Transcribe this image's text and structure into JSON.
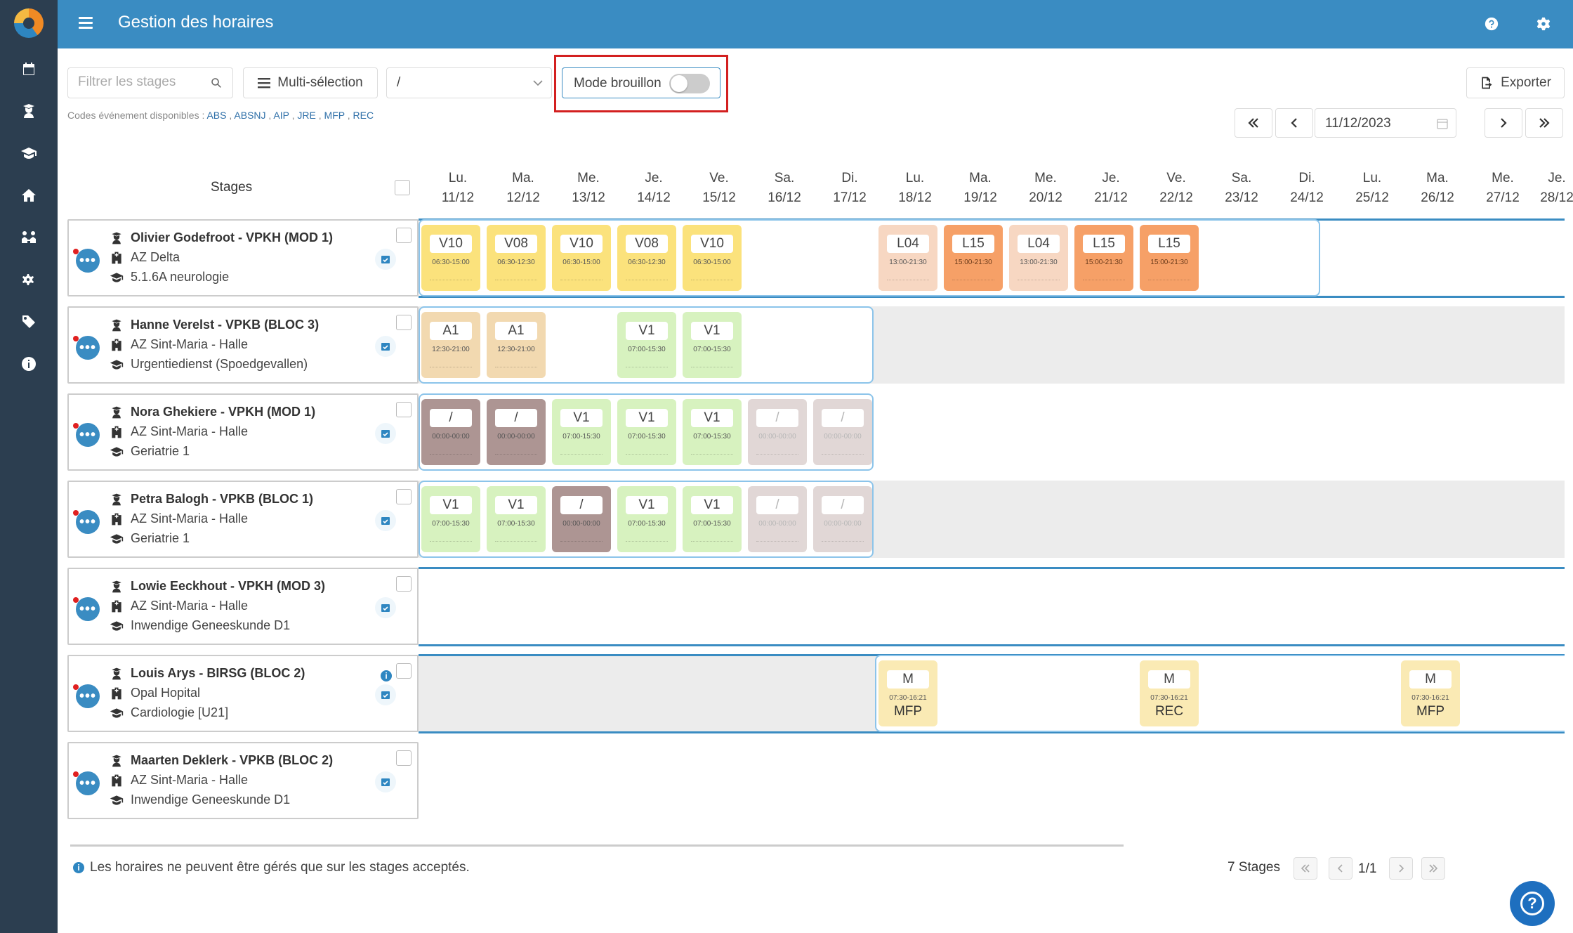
{
  "header": {
    "title": "Gestion des horaires"
  },
  "toolbar": {
    "search_placeholder": "Filtrer les stages",
    "multi_label": "Multi-sélection",
    "select_value": "/",
    "draft_label": "Mode brouillon",
    "draft_on": false,
    "export_label": "Exporter",
    "codes_label": "Codes événement disponibles :",
    "codes": [
      "ABS",
      "ABSNJ",
      "AIP",
      "JRE",
      "MFP",
      "REC"
    ],
    "date": "11/12/2023"
  },
  "grid": {
    "stages_header": "Stages",
    "days": [
      {
        "d": "Lu.",
        "date": "11/12"
      },
      {
        "d": "Ma.",
        "date": "12/12"
      },
      {
        "d": "Me.",
        "date": "13/12"
      },
      {
        "d": "Je.",
        "date": "14/12"
      },
      {
        "d": "Ve.",
        "date": "15/12"
      },
      {
        "d": "Sa.",
        "date": "16/12"
      },
      {
        "d": "Di.",
        "date": "17/12"
      },
      {
        "d": "Lu.",
        "date": "18/12"
      },
      {
        "d": "Ma.",
        "date": "19/12"
      },
      {
        "d": "Me.",
        "date": "20/12"
      },
      {
        "d": "Je.",
        "date": "21/12"
      },
      {
        "d": "Ve.",
        "date": "22/12"
      },
      {
        "d": "Sa.",
        "date": "23/12"
      },
      {
        "d": "Di.",
        "date": "24/12"
      },
      {
        "d": "Lu.",
        "date": "25/12"
      },
      {
        "d": "Ma.",
        "date": "26/12"
      },
      {
        "d": "Me.",
        "date": "27/12"
      },
      {
        "d": "Je.",
        "date": "28/12"
      }
    ],
    "colors": {
      "yellow": "#fbe27c",
      "peach": "#f7d7c2",
      "orange": "#f6a067",
      "tan": "#f2d9b0",
      "green": "#d7f2bf",
      "brown": "#ad9593",
      "lightbrown": "#dcd1cf",
      "cream": "#faeab4"
    },
    "rows": [
      {
        "name": "Olivier Godefroot - VPKH (MOD 1)",
        "hospital": "AZ Delta",
        "service": "5.1.6A neurologie",
        "shifts": [
          {
            "day": 0,
            "code": "V10",
            "time": "06:30-15:00",
            "color": "yellow"
          },
          {
            "day": 1,
            "code": "V08",
            "time": "06:30-12:30",
            "color": "yellow"
          },
          {
            "day": 2,
            "code": "V10",
            "time": "06:30-15:00",
            "color": "yellow"
          },
          {
            "day": 3,
            "code": "V08",
            "time": "06:30-12:30",
            "color": "yellow"
          },
          {
            "day": 4,
            "code": "V10",
            "time": "06:30-15:00",
            "color": "yellow"
          },
          {
            "day": 7,
            "code": "L04",
            "time": "13:00-21:30",
            "color": "peach"
          },
          {
            "day": 8,
            "code": "L15",
            "time": "15:00-21:30",
            "color": "orange"
          },
          {
            "day": 9,
            "code": "L04",
            "time": "13:00-21:30",
            "color": "peach"
          },
          {
            "day": 10,
            "code": "L15",
            "time": "15:00-21:30",
            "color": "orange"
          },
          {
            "day": 11,
            "code": "L15",
            "time": "15:00-21:30",
            "color": "orange"
          }
        ]
      },
      {
        "name": "Hanne Verelst - VPKB (BLOC 3)",
        "hospital": "AZ Sint-Maria - Halle",
        "service": "Urgentiedienst (Spoedgevallen)",
        "shifts": [
          {
            "day": 0,
            "code": "A1",
            "time": "12:30-21:00",
            "color": "tan"
          },
          {
            "day": 1,
            "code": "A1",
            "time": "12:30-21:00",
            "color": "tan"
          },
          {
            "day": 3,
            "code": "V1",
            "time": "07:00-15:30",
            "color": "green"
          },
          {
            "day": 4,
            "code": "V1",
            "time": "07:00-15:30",
            "color": "green"
          }
        ]
      },
      {
        "name": "Nora Ghekiere - VPKH (MOD 1)",
        "hospital": "AZ Sint-Maria - Halle",
        "service": "Geriatrie 1",
        "shifts": [
          {
            "day": 0,
            "code": "/",
            "time": "00:00-00:00",
            "color": "brown"
          },
          {
            "day": 1,
            "code": "/",
            "time": "00:00-00:00",
            "color": "brown"
          },
          {
            "day": 2,
            "code": "V1",
            "time": "07:00-15:30",
            "color": "green"
          },
          {
            "day": 3,
            "code": "V1",
            "time": "07:00-15:30",
            "color": "green"
          },
          {
            "day": 4,
            "code": "V1",
            "time": "07:00-15:30",
            "color": "green"
          },
          {
            "day": 5,
            "code": "/",
            "time": "00:00-00:00",
            "color": "lightbrown"
          },
          {
            "day": 6,
            "code": "/",
            "time": "00:00-00:00",
            "color": "lightbrown"
          }
        ]
      },
      {
        "name": "Petra Balogh - VPKB (BLOC 1)",
        "hospital": "AZ Sint-Maria - Halle",
        "service": "Geriatrie 1",
        "shifts": [
          {
            "day": 0,
            "code": "V1",
            "time": "07:00-15:30",
            "color": "green"
          },
          {
            "day": 1,
            "code": "V1",
            "time": "07:00-15:30",
            "color": "green"
          },
          {
            "day": 2,
            "code": "/",
            "time": "00:00-00:00",
            "color": "brown"
          },
          {
            "day": 3,
            "code": "V1",
            "time": "07:00-15:30",
            "color": "green"
          },
          {
            "day": 4,
            "code": "V1",
            "time": "07:00-15:30",
            "color": "green"
          },
          {
            "day": 5,
            "code": "/",
            "time": "00:00-00:00",
            "color": "lightbrown"
          },
          {
            "day": 6,
            "code": "/",
            "time": "00:00-00:00",
            "color": "lightbrown"
          }
        ]
      },
      {
        "name": "Lowie Eeckhout - VPKH (MOD 3)",
        "hospital": "AZ Sint-Maria - Halle",
        "service": "Inwendige Geneeskunde D1",
        "shifts": []
      },
      {
        "name": "Louis Arys - BIRSG (BLOC 2)",
        "hospital": "Opal Hopital",
        "service": "Cardiologie [U21]",
        "shifts": [
          {
            "day": 7,
            "code": "M",
            "time": "07:30-16:21",
            "event": "MFP",
            "color": "cream"
          },
          {
            "day": 11,
            "code": "M",
            "time": "07:30-16:21",
            "event": "REC",
            "color": "cream"
          },
          {
            "day": 15,
            "code": "M",
            "time": "07:30-16:21",
            "event": "MFP",
            "color": "cream"
          }
        ]
      },
      {
        "name": "Maarten Deklerk - VPKB (BLOC 2)",
        "hospital": "AZ Sint-Maria - Halle",
        "service": "Inwendige Geneeskunde D1",
        "shifts": []
      }
    ]
  },
  "footer": {
    "note": "Les horaires ne peuvent être gérés que sur les stages acceptés.",
    "count": "7 Stages",
    "page": "1/1"
  }
}
